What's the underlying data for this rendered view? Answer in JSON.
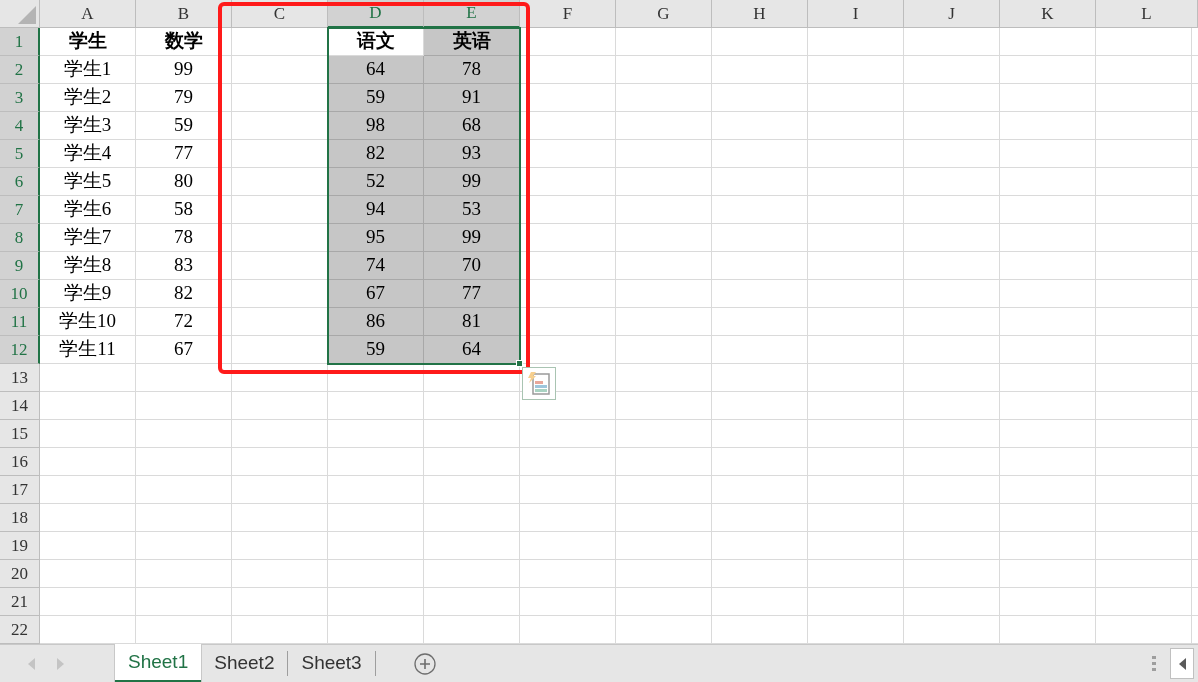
{
  "columns": [
    {
      "label": "A",
      "selected": false
    },
    {
      "label": "B",
      "selected": false
    },
    {
      "label": "C",
      "selected": false
    },
    {
      "label": "D",
      "selected": true
    },
    {
      "label": "E",
      "selected": true
    },
    {
      "label": "F",
      "selected": false
    },
    {
      "label": "G",
      "selected": false
    },
    {
      "label": "H",
      "selected": false
    },
    {
      "label": "I",
      "selected": false
    },
    {
      "label": "J",
      "selected": false
    },
    {
      "label": "K",
      "selected": false
    },
    {
      "label": "L",
      "selected": false
    }
  ],
  "rows": [
    {
      "label": "1",
      "selected": true,
      "kind": "header",
      "cells": [
        {
          "value": "学生",
          "selected": false
        },
        {
          "value": "数学",
          "selected": false
        },
        {
          "selected": false
        },
        {
          "value": "语文",
          "selected": true,
          "active": true
        },
        {
          "value": "英语",
          "selected": true,
          "active": false
        }
      ]
    },
    {
      "label": "2",
      "selected": true,
      "kind": "data",
      "cells": [
        {
          "value": "学生1",
          "selected": false
        },
        {
          "value": "99",
          "selected": false
        },
        {
          "selected": false
        },
        {
          "value": "64",
          "selected": true,
          "active": false
        },
        {
          "value": "78",
          "selected": true,
          "active": false
        }
      ]
    },
    {
      "label": "3",
      "selected": true,
      "kind": "data",
      "cells": [
        {
          "value": "学生2",
          "selected": false
        },
        {
          "value": "79",
          "selected": false
        },
        {
          "selected": false
        },
        {
          "value": "59",
          "selected": true,
          "active": false
        },
        {
          "value": "91",
          "selected": true,
          "active": false
        }
      ]
    },
    {
      "label": "4",
      "selected": true,
      "kind": "data",
      "cells": [
        {
          "value": "学生3",
          "selected": false
        },
        {
          "value": "59",
          "selected": false
        },
        {
          "selected": false
        },
        {
          "value": "98",
          "selected": true,
          "active": false
        },
        {
          "value": "68",
          "selected": true,
          "active": false
        }
      ]
    },
    {
      "label": "5",
      "selected": true,
      "kind": "data",
      "cells": [
        {
          "value": "学生4",
          "selected": false
        },
        {
          "value": "77",
          "selected": false
        },
        {
          "selected": false
        },
        {
          "value": "82",
          "selected": true,
          "active": false
        },
        {
          "value": "93",
          "selected": true,
          "active": false
        }
      ]
    },
    {
      "label": "6",
      "selected": true,
      "kind": "data",
      "cells": [
        {
          "value": "学生5",
          "selected": false
        },
        {
          "value": "80",
          "selected": false
        },
        {
          "selected": false
        },
        {
          "value": "52",
          "selected": true,
          "active": false
        },
        {
          "value": "99",
          "selected": true,
          "active": false
        }
      ]
    },
    {
      "label": "7",
      "selected": true,
      "kind": "data",
      "cells": [
        {
          "value": "学生6",
          "selected": false
        },
        {
          "value": "58",
          "selected": false
        },
        {
          "selected": false
        },
        {
          "value": "94",
          "selected": true,
          "active": false
        },
        {
          "value": "53",
          "selected": true,
          "active": false
        }
      ]
    },
    {
      "label": "8",
      "selected": true,
      "kind": "data",
      "cells": [
        {
          "value": "学生7",
          "selected": false
        },
        {
          "value": "78",
          "selected": false
        },
        {
          "selected": false
        },
        {
          "value": "95",
          "selected": true,
          "active": false
        },
        {
          "value": "99",
          "selected": true,
          "active": false
        }
      ]
    },
    {
      "label": "9",
      "selected": true,
      "kind": "data",
      "cells": [
        {
          "value": "学生8",
          "selected": false
        },
        {
          "value": "83",
          "selected": false
        },
        {
          "selected": false
        },
        {
          "value": "74",
          "selected": true,
          "active": false
        },
        {
          "value": "70",
          "selected": true,
          "active": false
        }
      ]
    },
    {
      "label": "10",
      "selected": true,
      "kind": "data",
      "cells": [
        {
          "value": "学生9",
          "selected": false
        },
        {
          "value": "82",
          "selected": false
        },
        {
          "selected": false
        },
        {
          "value": "67",
          "selected": true,
          "active": false
        },
        {
          "value": "77",
          "selected": true,
          "active": false
        }
      ]
    },
    {
      "label": "11",
      "selected": true,
      "kind": "data",
      "cells": [
        {
          "value": "学生10",
          "selected": false
        },
        {
          "value": "72",
          "selected": false
        },
        {
          "selected": false
        },
        {
          "value": "86",
          "selected": true,
          "active": false
        },
        {
          "value": "81",
          "selected": true,
          "active": false
        }
      ]
    },
    {
      "label": "12",
      "selected": true,
      "kind": "data",
      "cells": [
        {
          "value": "学生11",
          "selected": false
        },
        {
          "value": "67",
          "selected": false
        },
        {
          "selected": false
        },
        {
          "value": "59",
          "selected": true,
          "active": false
        },
        {
          "value": "64",
          "selected": true,
          "active": false
        }
      ]
    },
    {
      "label": "13",
      "selected": false,
      "kind": "data"
    },
    {
      "label": "14",
      "selected": false,
      "kind": "data"
    },
    {
      "label": "15",
      "selected": false,
      "kind": "data"
    },
    {
      "label": "16",
      "selected": false,
      "kind": "data"
    },
    {
      "label": "17",
      "selected": false,
      "kind": "data"
    },
    {
      "label": "18",
      "selected": false,
      "kind": "data"
    },
    {
      "label": "19",
      "selected": false,
      "kind": "data"
    },
    {
      "label": "20",
      "selected": false,
      "kind": "data"
    },
    {
      "label": "21",
      "selected": false,
      "kind": "data"
    },
    {
      "label": "22",
      "selected": false,
      "kind": "data"
    }
  ],
  "sheet_tabs": [
    {
      "label": "Sheet1",
      "selected": true
    },
    {
      "label": "Sheet2",
      "selected": false
    },
    {
      "label": "Sheet3",
      "selected": false
    }
  ]
}
